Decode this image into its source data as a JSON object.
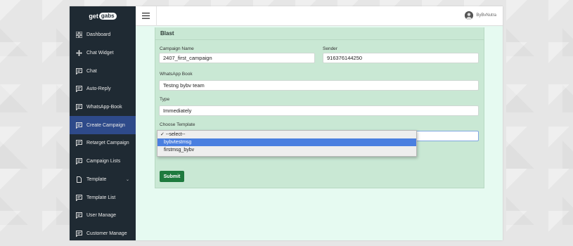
{
  "brand": {
    "logo_left": "get",
    "logo_right": "gabs"
  },
  "sidebar": {
    "items": [
      {
        "label": "Dashboard",
        "icon": "grid-icon"
      },
      {
        "label": "Chat Widget",
        "icon": "move-icon"
      },
      {
        "label": "Chat",
        "icon": "message-icon"
      },
      {
        "label": "Auto-Reply",
        "icon": "message-icon"
      },
      {
        "label": "WhatsApp-Book",
        "icon": "message-icon"
      },
      {
        "label": "Create Campaign",
        "icon": "message-icon",
        "active": true
      },
      {
        "label": "Retarget Campaign",
        "icon": "message-icon"
      },
      {
        "label": "Campaign Lists",
        "icon": "message-icon"
      },
      {
        "label": "Template",
        "icon": "file-icon",
        "has_chevron": true,
        "chevron": "⌄"
      },
      {
        "label": "Template List",
        "icon": "message-icon"
      },
      {
        "label": "User Manage",
        "icon": "message-icon"
      },
      {
        "label": "Customer Manage",
        "icon": "message-icon"
      }
    ]
  },
  "header": {
    "username": "ByBvNutra"
  },
  "form": {
    "card_title": "Blast",
    "campaign_name_label": "Campaign Name",
    "campaign_name_value": "2407_first_campaign",
    "sender_label": "Sender",
    "sender_value": "916376144250",
    "whatsapp_book_label": "WhatsApp Book",
    "whatsapp_book_value": "Testng bybv team",
    "type_label": "Type",
    "type_value": "Immediately",
    "template_label": "Choose Template",
    "template_options": [
      "--select--",
      "bybvtestmsg",
      "firstmsg_bybv"
    ],
    "template_selected_mark": "✓",
    "template_highlighted": "bybvtestmsg",
    "submit_label": "Submit"
  },
  "colors": {
    "sidebar_bg": "#1f2a33",
    "active_item": "#2e4a8a",
    "card_bg": "#c9e8d4",
    "submit_bg": "#1e7a3e",
    "highlight": "#4a7fe0"
  }
}
